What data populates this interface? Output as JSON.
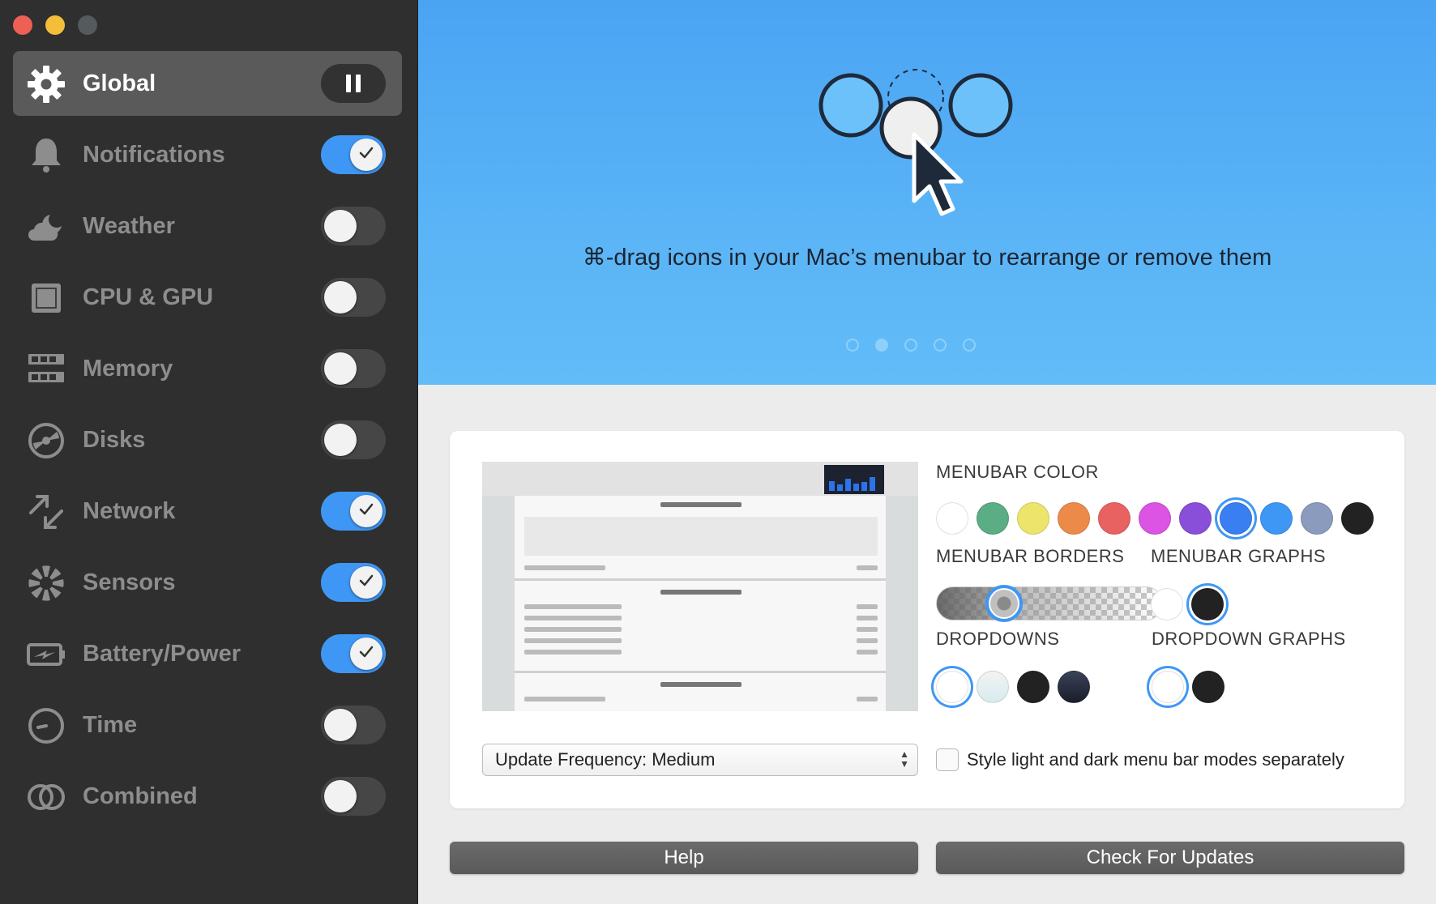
{
  "sidebar": {
    "items": [
      {
        "label": "Global",
        "icon": "gear-icon",
        "state": "pause",
        "selected": true
      },
      {
        "label": "Notifications",
        "icon": "bell-icon",
        "state": "on"
      },
      {
        "label": "Weather",
        "icon": "weather-icon",
        "state": "off"
      },
      {
        "label": "CPU & GPU",
        "icon": "cpu-icon",
        "state": "off"
      },
      {
        "label": "Memory",
        "icon": "memory-icon",
        "state": "off"
      },
      {
        "label": "Disks",
        "icon": "disk-icon",
        "state": "off"
      },
      {
        "label": "Network",
        "icon": "network-icon",
        "state": "on"
      },
      {
        "label": "Sensors",
        "icon": "sensors-icon",
        "state": "on"
      },
      {
        "label": "Battery/Power",
        "icon": "battery-icon",
        "state": "on"
      },
      {
        "label": "Time",
        "icon": "clock-icon",
        "state": "off"
      },
      {
        "label": "Combined",
        "icon": "combined-icon",
        "state": "off"
      }
    ]
  },
  "hero": {
    "caption": "⌘-drag icons in your Mac’s menubar to rearrange or remove them",
    "page_count": 5,
    "active_page": 2
  },
  "settings": {
    "menubar_color_label": "MENUBAR COLOR",
    "menubar_colors": [
      "#ffffff",
      "#5aad84",
      "#ede46c",
      "#ec8a4a",
      "#e96262",
      "#db54e3",
      "#8a4fd9",
      "#3a7ff2",
      "#3f97f5",
      "#8a9bbd",
      "#222222"
    ],
    "menubar_color_selected": 7,
    "menubar_borders_label": "MENUBAR BORDERS",
    "menubar_borders_value": 0.3,
    "menubar_graphs_label": "MENUBAR GRAPHS",
    "menubar_graphs": [
      "#ffffff",
      "#222222"
    ],
    "menubar_graphs_selected": 1,
    "dropdowns_label": "DROPDOWNS",
    "dropdowns": [
      "#ffffff",
      "#e3eef0",
      "#222222",
      "#283046"
    ],
    "dropdowns_selected": 0,
    "dropdown_graphs_label": "DROPDOWN GRAPHS",
    "dropdown_graphs": [
      "#ffffff",
      "#222222"
    ],
    "dropdown_graphs_selected": 0,
    "update_frequency": "Update Frequency: Medium",
    "style_separately_label": "Style light and dark menu bar modes separately",
    "style_separately_checked": false
  },
  "buttons": {
    "help": "Help",
    "check_updates": "Check For Updates"
  }
}
